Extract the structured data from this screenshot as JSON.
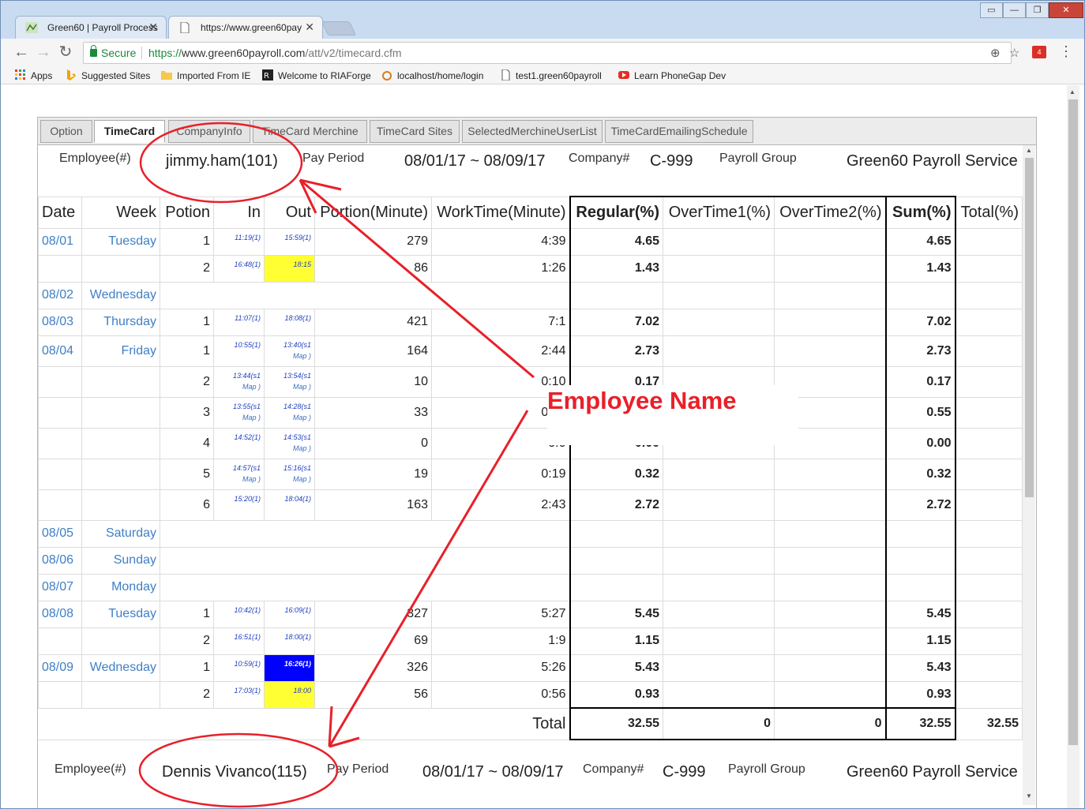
{
  "browser": {
    "tabs": [
      {
        "title": "Green60 | Payroll Process",
        "active": false
      },
      {
        "title": "https://www.green60pay",
        "active": true
      }
    ],
    "secure_label": "Secure",
    "url_scheme": "https://",
    "url_host": "www.green60payroll.com",
    "url_path": "/att/v2/timecard.cfm",
    "extension_badge": "4",
    "bookmarks": [
      "Apps",
      "Suggested Sites",
      "Imported From IE",
      "Welcome to RIAForge",
      "localhost/home/login",
      "test1.green60payroll",
      "Learn PhoneGap Dev"
    ]
  },
  "app_tabs": [
    "Option",
    "TimeCard",
    "CompanyInfo",
    "TimeCard Merchine",
    "TimeCard Sites",
    "SelectedMerchineUserList",
    "TimeCardEmailingSchedule"
  ],
  "active_tab": "TimeCard",
  "header1": {
    "employee_label": "Employee(#)",
    "employee_value": "jimmy.ham(101)",
    "pay_period_label": "Pay Period",
    "pay_period_value": "08/01/17 ~ 08/09/17",
    "company_label": "Company#",
    "company_value": "C-999",
    "payroll_group_label": "Payroll Group",
    "payroll_group_value": "Green60 Payroll Service"
  },
  "columns": [
    "Date",
    "Week",
    "Potion",
    "In",
    "Out",
    "Portion(Minute)",
    "WorkTime(Minute)",
    "Regular(%)",
    "OverTime1(%)",
    "OverTime2(%)",
    "Sum(%)",
    "Total(%)"
  ],
  "rows": [
    {
      "date": "08/01",
      "week": "Tuesday",
      "portion": "1",
      "in": "11:19(1)",
      "out": "15:59(1)",
      "pmin": "279",
      "wt": "4:39",
      "reg": "4.65",
      "sum": "4.65"
    },
    {
      "date": "",
      "week": "",
      "portion": "2",
      "in": "16:48(1)",
      "out": "18:15",
      "out_hl": "yellow",
      "pmin": "86",
      "wt": "1:26",
      "reg": "1.43",
      "sum": "1.43"
    },
    {
      "date": "08/02",
      "week": "Wednesday",
      "empty": true
    },
    {
      "date": "08/03",
      "week": "Thursday",
      "portion": "1",
      "in": "11:07(1)",
      "out": "18:08(1)",
      "pmin": "421",
      "wt": "7:1",
      "reg": "7.02",
      "sum": "7.02"
    },
    {
      "date": "08/04",
      "week": "Friday",
      "portion": "1",
      "in": "10:55(1)",
      "out": "13:40(s1",
      "out_map": "Map )",
      "pmin": "164",
      "wt": "2:44",
      "reg": "2.73",
      "sum": "2.73",
      "tall": true
    },
    {
      "date": "",
      "week": "",
      "portion": "2",
      "in": "13:44(s1",
      "in_map": "Map )",
      "out": "13:54(s1",
      "out_map": "Map )",
      "pmin": "10",
      "wt": "0:10",
      "reg": "0.17",
      "sum": "0.17",
      "tall": true
    },
    {
      "date": "",
      "week": "",
      "portion": "3",
      "in": "13:55(s1",
      "in_map": "Map )",
      "out": "14:28(s1",
      "out_map": "Map )",
      "pmin": "33",
      "wt": "0:33",
      "reg": "0.55",
      "sum": "0.55",
      "tall": true
    },
    {
      "date": "",
      "week": "",
      "portion": "4",
      "in": "14:52(1)",
      "out": "14:53(s1",
      "out_map": "Map )",
      "pmin": "0",
      "wt": "0:0",
      "reg": "0.00",
      "sum": "0.00",
      "tall": true
    },
    {
      "date": "",
      "week": "",
      "portion": "5",
      "in": "14:57(s1",
      "in_map": "Map )",
      "out": "15:16(s1",
      "out_map": "Map )",
      "pmin": "19",
      "wt": "0:19",
      "reg": "0.32",
      "sum": "0.32",
      "tall": true
    },
    {
      "date": "",
      "week": "",
      "portion": "6",
      "in": "15:20(1)",
      "out": "18:04(1)",
      "pmin": "163",
      "wt": "2:43",
      "reg": "2.72",
      "sum": "2.72",
      "tall": true
    },
    {
      "date": "08/05",
      "week": "Saturday",
      "empty": true
    },
    {
      "date": "08/06",
      "week": "Sunday",
      "empty": true
    },
    {
      "date": "08/07",
      "week": "Monday",
      "empty": true
    },
    {
      "date": "08/08",
      "week": "Tuesday",
      "portion": "1",
      "in": "10:42(1)",
      "out": "16:09(1)",
      "pmin": "327",
      "wt": "5:27",
      "reg": "5.45",
      "sum": "5.45"
    },
    {
      "date": "",
      "week": "",
      "portion": "2",
      "in": "16:51(1)",
      "out": "18:00(1)",
      "pmin": "69",
      "wt": "1:9",
      "reg": "1.15",
      "sum": "1.15"
    },
    {
      "date": "08/09",
      "week": "Wednesday",
      "portion": "1",
      "in": "10:59(1)",
      "out": "16:26(1)",
      "out_hl": "blue",
      "pmin": "326",
      "wt": "5:26",
      "reg": "5.43",
      "sum": "5.43"
    },
    {
      "date": "",
      "week": "",
      "portion": "2",
      "in": "17:03(1)",
      "out": "18:00",
      "out_hl": "yellow",
      "pmin": "56",
      "wt": "0:56",
      "reg": "0.93",
      "sum": "0.93"
    }
  ],
  "totals": {
    "label": "Total",
    "regular": "32.55",
    "ot1": "0",
    "ot2": "0",
    "sum": "32.55",
    "total": "32.55"
  },
  "header2": {
    "employee_label": "Employee(#)",
    "employee_value": "Dennis Vivanco(115)",
    "pay_period_label": "Pay Period",
    "pay_period_value": "08/01/17 ~ 08/09/17",
    "company_label": "Company#",
    "company_value": "C-999",
    "payroll_group_label": "Payroll Group",
    "payroll_group_value": "Green60 Payroll Service"
  },
  "annotation": {
    "label": "Employee Name",
    "color": "#e8202a"
  },
  "colors": {
    "link": "#3f7fc6",
    "highlight_yellow": "#ffff33",
    "highlight_blue": "#0000ff"
  }
}
